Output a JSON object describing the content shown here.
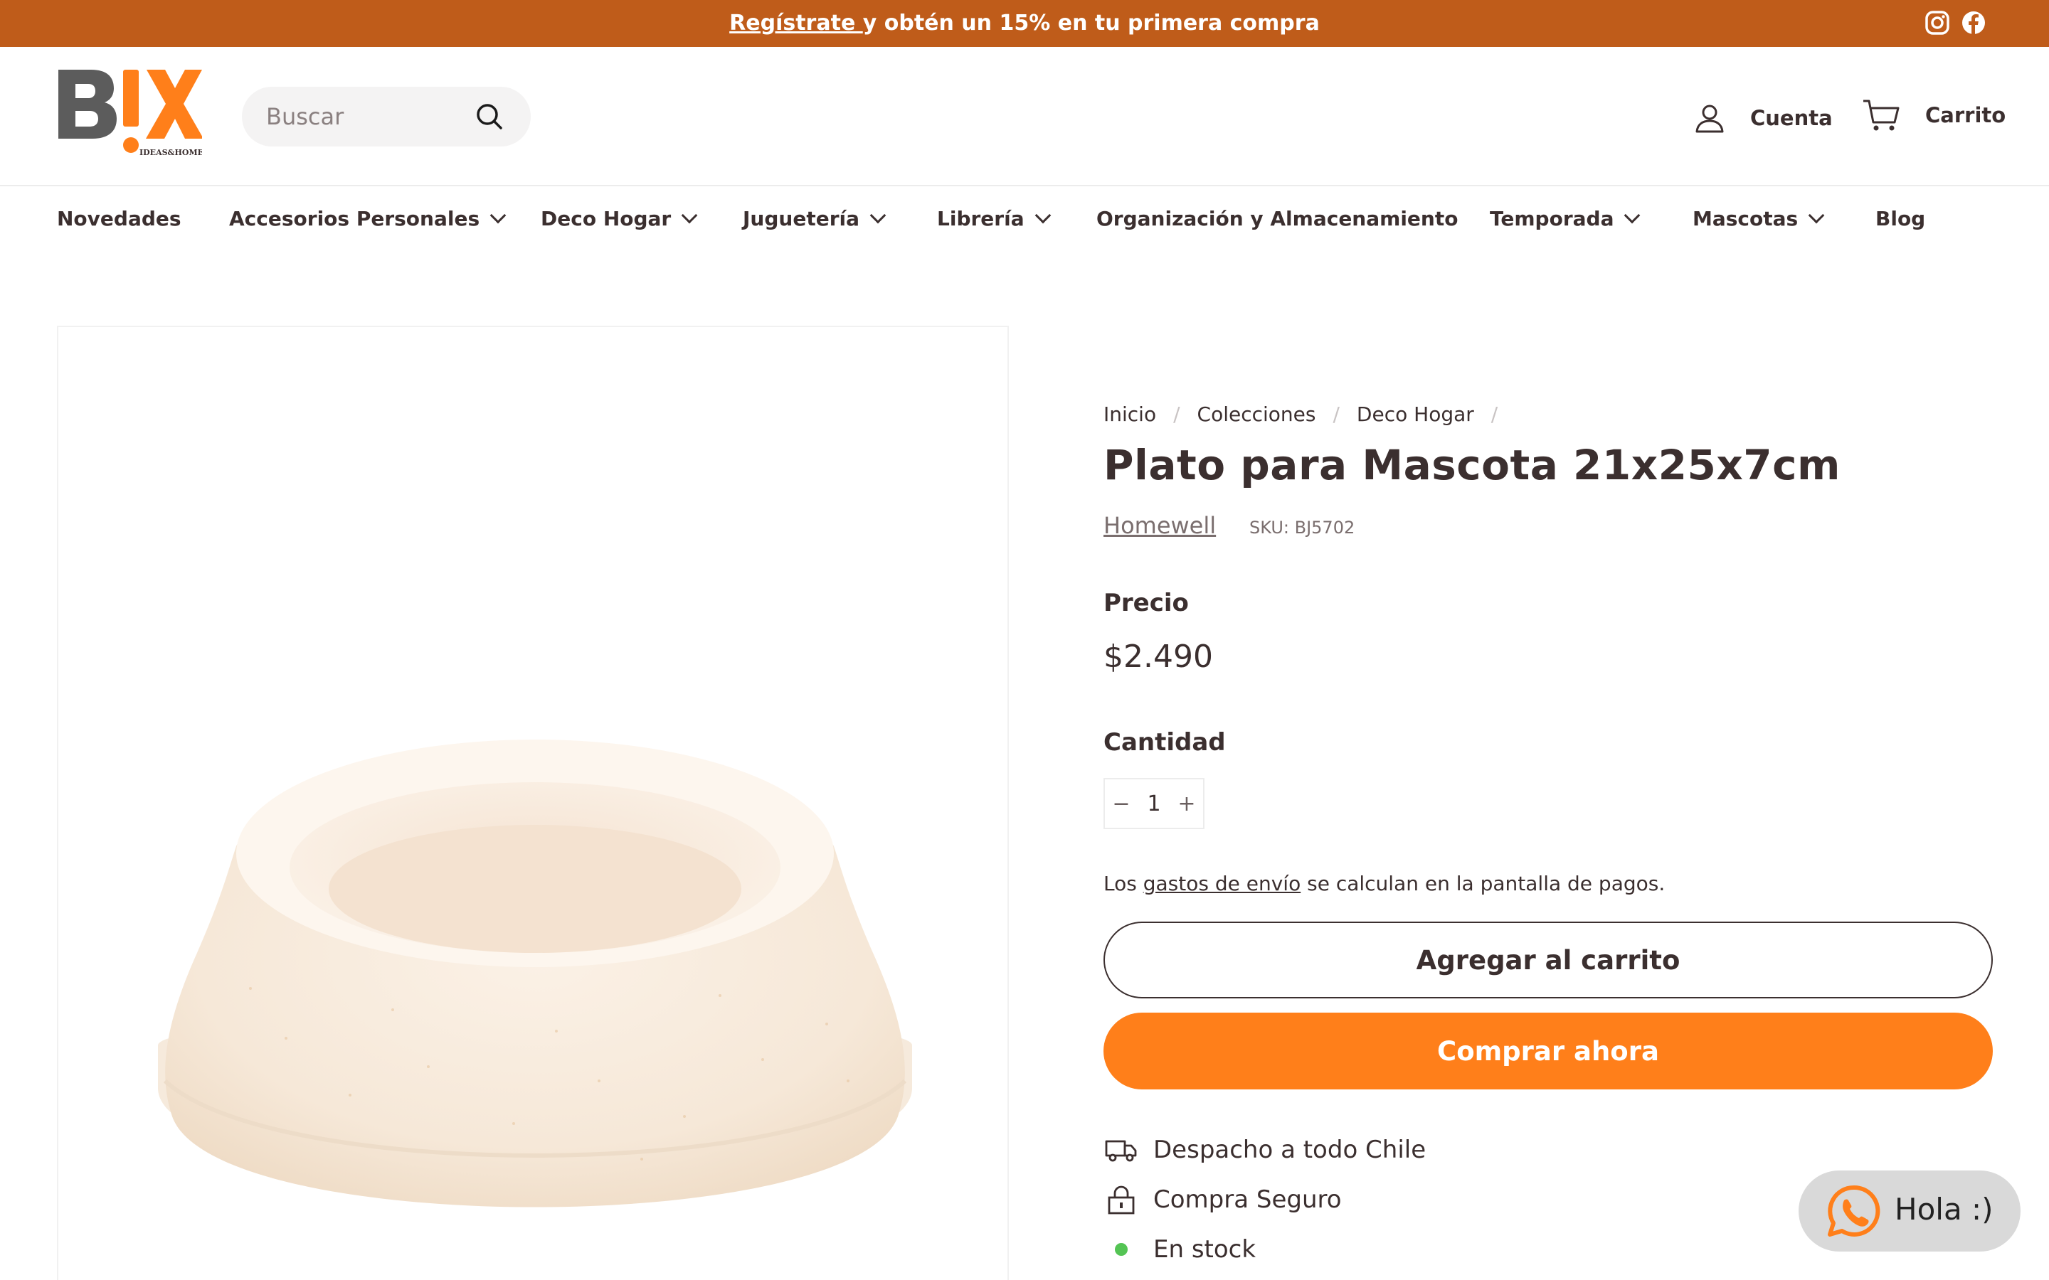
{
  "announcement": {
    "link_text": "Regístrate ",
    "text": "y obtén un 15% en tu primera compra",
    "social": [
      "instagram-icon",
      "facebook-icon"
    ]
  },
  "header": {
    "logo_text": "BIX",
    "logo_tagline": "IDEAS&HOME",
    "search_placeholder": "Buscar",
    "account_label": "Cuenta",
    "cart_label": "Carrito"
  },
  "nav": {
    "items": [
      {
        "label": "Novedades",
        "dropdown": false
      },
      {
        "label": "Accesorios Personales",
        "dropdown": true
      },
      {
        "label": "Deco Hogar",
        "dropdown": true
      },
      {
        "label": "Juguetería",
        "dropdown": true
      },
      {
        "label": "Librería",
        "dropdown": true
      },
      {
        "label": "Organización y Almacenamiento",
        "dropdown": false
      },
      {
        "label": "Temporada",
        "dropdown": true
      },
      {
        "label": "Mascotas",
        "dropdown": true
      },
      {
        "label": "Blog",
        "dropdown": false
      }
    ]
  },
  "breadcrumb": [
    "Inicio",
    "Colecciones",
    "Deco Hogar"
  ],
  "product": {
    "title": "Plato para Mascota 21x25x7cm",
    "vendor": "Homewell",
    "sku": "SKU: BJ5702",
    "price_label": "Precio",
    "price": "$2.490",
    "quantity_label": "Cantidad",
    "quantity": "1",
    "minus": "−",
    "plus": "+",
    "shipping_pre": "Los ",
    "shipping_link": "gastos de envío",
    "shipping_post": " se calculan en la pantalla de pagos.",
    "add_to_cart": "Agregar al carrito",
    "buy_now": "Comprar ahora"
  },
  "features": [
    {
      "icon": "truck-icon",
      "text": "Despacho a todo Chile"
    },
    {
      "icon": "lock-icon",
      "text": "Compra Seguro"
    },
    {
      "icon": "stock-dot-icon",
      "text": "En stock"
    }
  ],
  "chat": {
    "label": "Hola :)",
    "icon": "whatsapp-icon"
  },
  "colors": {
    "announcement_bg": "#bf5c1a",
    "accent": "#ff7f1a",
    "text": "#3b2f2f",
    "stock": "#54c454"
  }
}
